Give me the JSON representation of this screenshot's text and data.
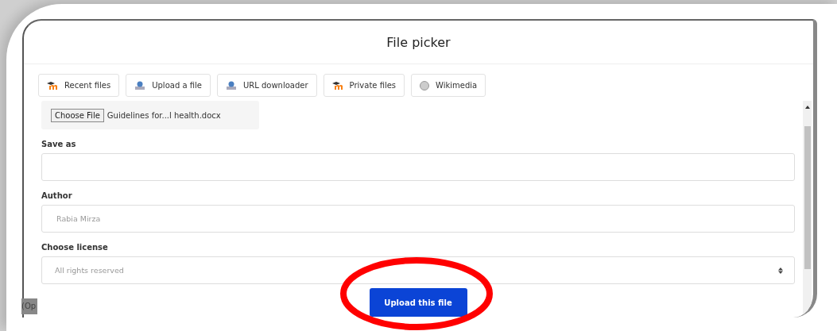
{
  "dialog": {
    "title": "File picker"
  },
  "tabs": [
    {
      "label": "Recent files",
      "kind": "moodle"
    },
    {
      "label": "Upload a file",
      "kind": "upload"
    },
    {
      "label": "URL downloader",
      "kind": "upload"
    },
    {
      "label": "Private files",
      "kind": "moodle"
    },
    {
      "label": "Wikimedia",
      "kind": "globe"
    }
  ],
  "file_input": {
    "button": "Choose File",
    "filename": "Guidelines for...l health.docx"
  },
  "fields": [
    {
      "label": "Save as",
      "kind": "text"
    },
    {
      "label": "Author",
      "kind": "text",
      "value": "Rabia Mirza"
    },
    {
      "label": "Choose license",
      "kind": "select",
      "value": "All rights reserved"
    }
  ],
  "upload_button": {
    "label": "Upload this file",
    "highlighted": true
  },
  "background_text": "(Op"
}
